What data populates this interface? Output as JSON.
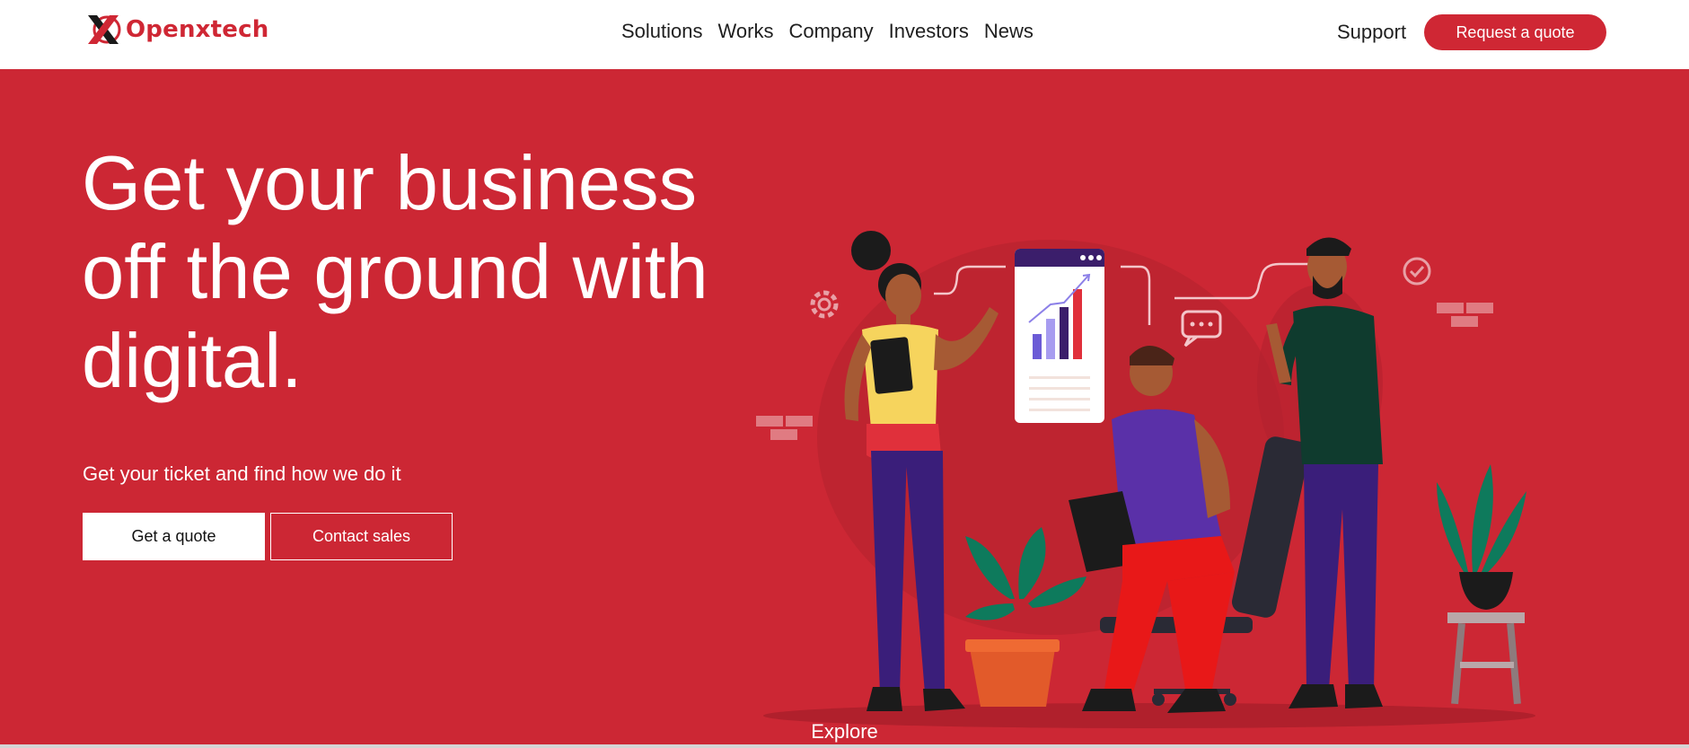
{
  "brand": {
    "name": "Openxtech",
    "accent": "#cc2734",
    "logo_icon": "x-logo-icon"
  },
  "nav": {
    "items": [
      "Solutions",
      "Works",
      "Company",
      "Investors",
      "News"
    ]
  },
  "header": {
    "support": "Support",
    "cta": "Request a quote"
  },
  "hero": {
    "title_lines": [
      "Get your business",
      "off the ground with",
      "digital."
    ],
    "tagline": "Get your ticket and find how we do it",
    "primary_button": "Get a quote",
    "secondary_button": "Contact sales",
    "explore": "Explore",
    "illustration": "team-working-illustration"
  }
}
